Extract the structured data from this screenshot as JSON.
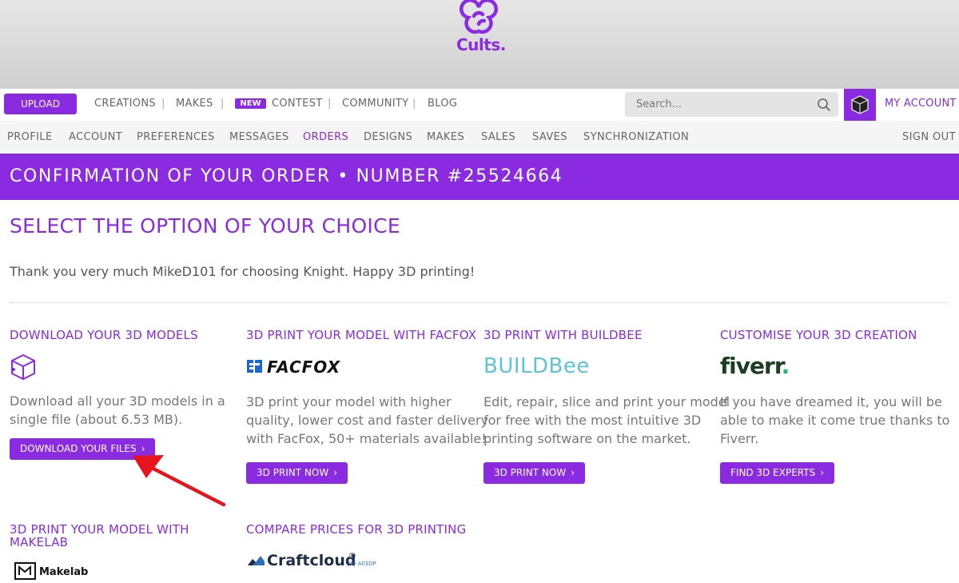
{
  "brand": {
    "logo_text": "Cults."
  },
  "topnav": {
    "upload_label": "UPLOAD",
    "links": [
      "CREATIONS",
      "MAKES",
      "CONTEST",
      "COMMUNITY",
      "BLOG"
    ],
    "new_badge": "NEW",
    "search_placeholder": "Search...",
    "my_account_label": "MY ACCOUNT"
  },
  "subnav": {
    "items": [
      "PROFILE",
      "ACCOUNT",
      "PREFERENCES",
      "MESSAGES",
      "ORDERS",
      "DESIGNS",
      "MAKES",
      "SALES",
      "SAVES",
      "SYNCHRONIZATION"
    ],
    "active": "ORDERS",
    "sign_out": "SIGN OUT"
  },
  "banner": {
    "title": "CONFIRMATION OF YOUR ORDER • NUMBER #25524664"
  },
  "main": {
    "section_title": "SELECT THE OPTION OF YOUR CHOICE",
    "thanks": "Thank you very much MikeD101 for choosing Knight. Happy 3D printing!"
  },
  "cards": [
    {
      "title": "DOWNLOAD YOUR 3D MODELS",
      "icon": "3d-box-download-icon",
      "desc_lines": [
        "Download all your 3D models in a",
        "single file (about 6.53 MB)."
      ],
      "button": "DOWNLOAD YOUR FILES"
    },
    {
      "title": "3D PRINT YOUR MODEL WITH FACFOX",
      "brand": "FACFOX",
      "desc_lines": [
        "3D print your model with higher",
        "quality, lower cost and faster delivery",
        "with FacFox, 50+ materials available!"
      ],
      "button": "3D PRINT NOW"
    },
    {
      "title": "3D PRINT WITH BUILDBEE",
      "brand": "BUILDBee",
      "desc_lines": [
        "Edit, repair, slice and print your model",
        "for free with the most intuitive 3D",
        "printing software on the market."
      ],
      "button": "3D PRINT NOW"
    },
    {
      "title": "CUSTOMISE YOUR 3D CREATION",
      "brand": "fiverr",
      "brand_dot": ".",
      "desc_lines": [
        "If you have dreamed it, you will be",
        "able to make it come true thanks to",
        "Fiverr."
      ],
      "button": "FIND 3D EXPERTS"
    },
    {
      "title_lines": [
        "3D PRINT YOUR MODEL WITH",
        "MAKELAB"
      ],
      "brand": "Makelab"
    },
    {
      "title": "COMPARE PRICES FOR 3D PRINTING",
      "brand": "Craftcloud",
      "brand_sup": "®",
      "brand_by": "by All3DP"
    }
  ],
  "colors": {
    "accent": "#8a2be2",
    "arrow": "#e8141b",
    "buildbee": "#5ec3d6",
    "fiverr": "#1c3f24",
    "fiverr_dot": "#1dbf73"
  }
}
